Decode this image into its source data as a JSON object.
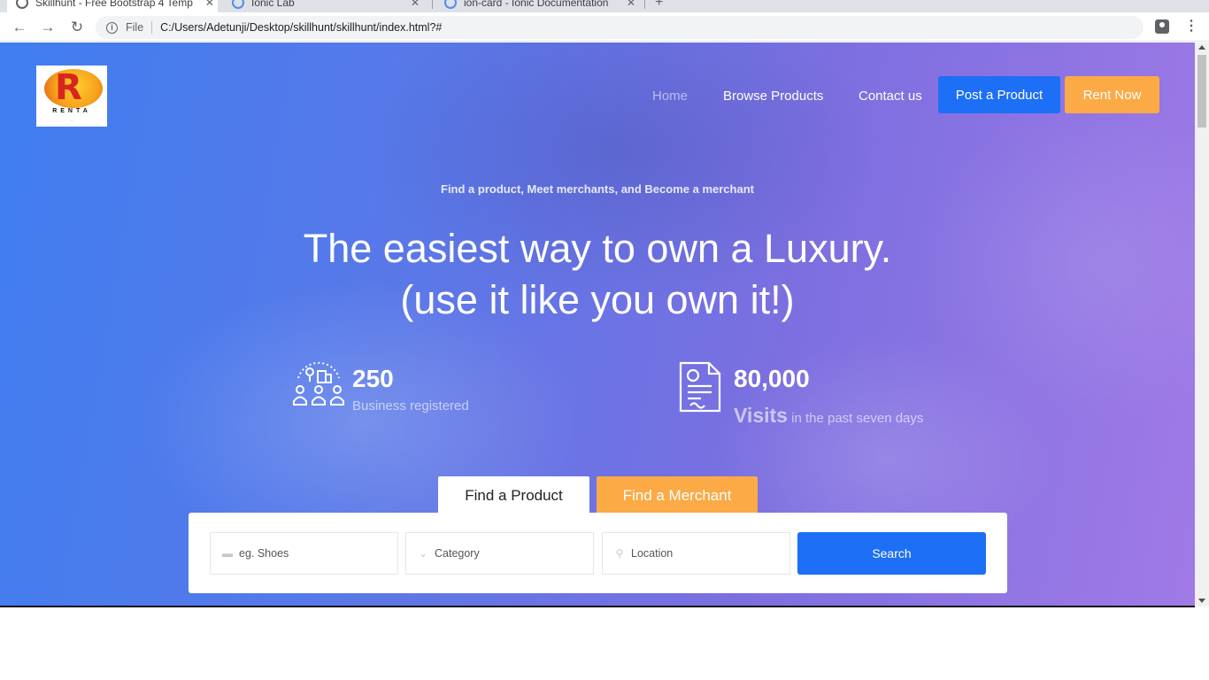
{
  "browser": {
    "tabs": [
      {
        "title": "Skillhunt - Free Bootstrap 4 Temp",
        "favicon": "globe-icon"
      },
      {
        "title": "Ionic Lab",
        "favicon": "ionic-icon"
      },
      {
        "title": "ion-card - Ionic Documentation",
        "favicon": "ionic-icon"
      }
    ],
    "new_tab": "+",
    "file_label": "File",
    "url": "C:/Users/Adetunji/Desktop/skillhunt/skillhunt/index.html?#"
  },
  "site": {
    "logo": {
      "letter": "R",
      "name": "RENTA",
      "tag": "..."
    },
    "nav": {
      "home": "Home",
      "browse": "Browse Products",
      "contact": "Contact us",
      "post": "Post a Product",
      "rent": "Rent Now"
    },
    "hero": {
      "tagline": "Find a product, Meet merchants, and Become a merchant",
      "headline_line1": "The easiest way to own a Luxury.",
      "headline_line2": "(use it like you own it!)"
    },
    "stats": [
      {
        "number": "250",
        "label": "Business registered",
        "icon": "business-people-icon"
      },
      {
        "number": "80,000",
        "label_bold": "Visits",
        "label": "in the past seven days",
        "icon": "document-icon"
      }
    ],
    "search": {
      "tabs": [
        "Find a Product",
        "Find a Merchant"
      ],
      "fields": {
        "keyword_placeholder": "eg. Shoes",
        "category_placeholder": "Category",
        "location_placeholder": "Location"
      },
      "button": "Search"
    }
  },
  "colors": {
    "primary_blue": "#1d6ff5",
    "accent_orange": "#fbaa45",
    "hero_gradient_start": "#3f7ef0",
    "hero_gradient_end": "#a07ae6"
  }
}
